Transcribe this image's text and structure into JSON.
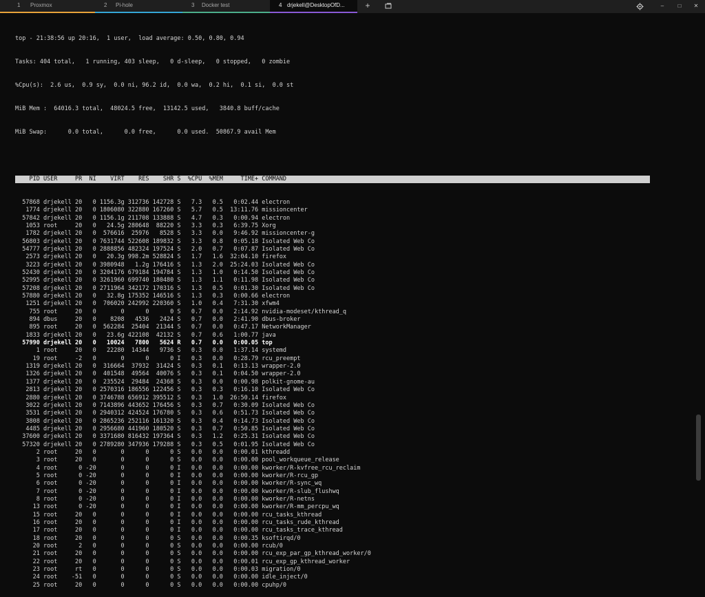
{
  "tabs": [
    {
      "num": "1",
      "title": "Proxmox",
      "color": "#e8a33a",
      "active": false
    },
    {
      "num": "2",
      "title": "Pi-hole",
      "color": "#35a6d6",
      "active": false
    },
    {
      "num": "3",
      "title": "Docker test",
      "color": "#4caf8b",
      "active": false
    },
    {
      "num": "4",
      "title": "drjekell@DesktopOfD...",
      "color": "#8a5ad6",
      "active": true
    }
  ],
  "toolbar": {
    "new_tab": "+",
    "menu_icon": "menu-icon",
    "settings_icon": "gear-icon"
  },
  "window": {
    "minimize": "–",
    "maximize": "□",
    "close": "✕"
  },
  "summary": [
    "top - 21:38:56 up 20:16,  1 user,  load average: 0.50, 0.80, 0.94",
    "Tasks: 404 total,   1 running, 403 sleep,   0 d-sleep,   0 stopped,   0 zombie",
    "%Cpu(s):  2.6 us,  0.9 sy,  0.0 ni, 96.2 id,  0.0 wa,  0.2 hi,  0.1 si,  0.0 st",
    "MiB Mem :  64016.3 total,  48024.5 free,  13142.5 used,   3840.8 buff/cache",
    "MiB Swap:      0.0 total,      0.0 free,      0.0 used.  50867.9 avail Mem"
  ],
  "columns": [
    "PID",
    "USER",
    "PR",
    "NI",
    "VIRT",
    "RES",
    "SHR",
    "S",
    "%CPU",
    "%MEM",
    "TIME+",
    "COMMAND"
  ],
  "processes": [
    [
      "57868",
      "drjekell",
      "20",
      "0",
      "1156.3g",
      "312736",
      "142728",
      "S",
      "7.3",
      "0.5",
      "0:02.44",
      "electron"
    ],
    [
      "1774",
      "drjekell",
      "20",
      "0",
      "1806080",
      "322880",
      "167260",
      "S",
      "5.7",
      "0.5",
      "13:11.76",
      "missioncenter"
    ],
    [
      "57842",
      "drjekell",
      "20",
      "0",
      "1156.1g",
      "211708",
      "133888",
      "S",
      "4.7",
      "0.3",
      "0:00.94",
      "electron"
    ],
    [
      "1053",
      "root",
      "20",
      "0",
      "24.5g",
      "280648",
      "88220",
      "S",
      "3.3",
      "0.3",
      "6:39.75",
      "Xorg"
    ],
    [
      "1782",
      "drjekell",
      "20",
      "0",
      "576616",
      "25976",
      "8528",
      "S",
      "3.3",
      "0.0",
      "9:46.92",
      "missioncenter-g"
    ],
    [
      "56803",
      "drjekell",
      "20",
      "0",
      "7631744",
      "522608",
      "189832",
      "S",
      "3.3",
      "0.8",
      "0:05.18",
      "Isolated Web Co"
    ],
    [
      "54777",
      "drjekell",
      "20",
      "0",
      "2888856",
      "482324",
      "197524",
      "S",
      "2.0",
      "0.7",
      "0:07.87",
      "Isolated Web Co"
    ],
    [
      "2573",
      "drjekell",
      "20",
      "0",
      "20.3g",
      "998.2m",
      "528824",
      "S",
      "1.7",
      "1.6",
      "32:04.10",
      "firefox"
    ],
    [
      "3223",
      "drjekell",
      "20",
      "0",
      "3980948",
      "1.2g",
      "176416",
      "S",
      "1.3",
      "2.0",
      "25:24.03",
      "Isolated Web Co"
    ],
    [
      "52430",
      "drjekell",
      "20",
      "0",
      "3204176",
      "679184",
      "194784",
      "S",
      "1.3",
      "1.0",
      "0:14.50",
      "Isolated Web Co"
    ],
    [
      "52995",
      "drjekell",
      "20",
      "0",
      "3261960",
      "699740",
      "180480",
      "S",
      "1.3",
      "1.1",
      "0:11.98",
      "Isolated Web Co"
    ],
    [
      "57208",
      "drjekell",
      "20",
      "0",
      "2711964",
      "342172",
      "170316",
      "S",
      "1.3",
      "0.5",
      "0:01.30",
      "Isolated Web Co"
    ],
    [
      "57880",
      "drjekell",
      "20",
      "0",
      "32.8g",
      "175352",
      "146516",
      "S",
      "1.3",
      "0.3",
      "0:00.66",
      "electron"
    ],
    [
      "1251",
      "drjekell",
      "20",
      "0",
      "706020",
      "242992",
      "220360",
      "S",
      "1.0",
      "0.4",
      "7:31.30",
      "xfwm4"
    ],
    [
      "755",
      "root",
      "20",
      "0",
      "0",
      "0",
      "0",
      "S",
      "0.7",
      "0.0",
      "2:14.92",
      "nvidia-modeset/kthread_q"
    ],
    [
      "894",
      "dbus",
      "20",
      "0",
      "8208",
      "4536",
      "2424",
      "S",
      "0.7",
      "0.0",
      "2:41.90",
      "dbus-broker"
    ],
    [
      "895",
      "root",
      "20",
      "0",
      "562284",
      "25404",
      "21344",
      "S",
      "0.7",
      "0.0",
      "0:47.17",
      "NetworkManager"
    ],
    [
      "1833",
      "drjekell",
      "20",
      "0",
      "23.6g",
      "422108",
      "42132",
      "S",
      "0.7",
      "0.6",
      "1:00.77",
      "java"
    ],
    [
      "57990",
      "drjekell",
      "20",
      "0",
      "10024",
      "7800",
      "5624",
      "R",
      "0.7",
      "0.0",
      "0:00.05",
      "top"
    ],
    [
      "1",
      "root",
      "20",
      "0",
      "22280",
      "14344",
      "9736",
      "S",
      "0.3",
      "0.0",
      "1:37.14",
      "systemd"
    ],
    [
      "19",
      "root",
      "-2",
      "0",
      "0",
      "0",
      "0",
      "I",
      "0.3",
      "0.0",
      "0:28.79",
      "rcu_preempt"
    ],
    [
      "1319",
      "drjekell",
      "20",
      "0",
      "316664",
      "37932",
      "31424",
      "S",
      "0.3",
      "0.1",
      "0:13.13",
      "wrapper-2.0"
    ],
    [
      "1326",
      "drjekell",
      "20",
      "0",
      "401548",
      "49564",
      "40076",
      "S",
      "0.3",
      "0.1",
      "0:04.50",
      "wrapper-2.0"
    ],
    [
      "1377",
      "drjekell",
      "20",
      "0",
      "235524",
      "29484",
      "24368",
      "S",
      "0.3",
      "0.0",
      "0:00.98",
      "polkit-gnome-au"
    ],
    [
      "2813",
      "drjekell",
      "20",
      "0",
      "2570316",
      "186556",
      "122456",
      "S",
      "0.3",
      "0.3",
      "0:16.10",
      "Isolated Web Co"
    ],
    [
      "2880",
      "drjekell",
      "20",
      "0",
      "3746788",
      "656912",
      "395512",
      "S",
      "0.3",
      "1.0",
      "26:50.14",
      "firefox"
    ],
    [
      "3022",
      "drjekell",
      "20",
      "0",
      "7143896",
      "443652",
      "176456",
      "S",
      "0.3",
      "0.7",
      "0:30.09",
      "Isolated Web Co"
    ],
    [
      "3531",
      "drjekell",
      "20",
      "0",
      "2940312",
      "424524",
      "176780",
      "S",
      "0.3",
      "0.6",
      "0:51.73",
      "Isolated Web Co"
    ],
    [
      "3808",
      "drjekell",
      "20",
      "0",
      "2865236",
      "252116",
      "161320",
      "S",
      "0.3",
      "0.4",
      "0:14.73",
      "Isolated Web Co"
    ],
    [
      "4485",
      "drjekell",
      "20",
      "0",
      "2956680",
      "441960",
      "180520",
      "S",
      "0.3",
      "0.7",
      "0:50.85",
      "Isolated Web Co"
    ],
    [
      "37600",
      "drjekell",
      "20",
      "0",
      "3371680",
      "816432",
      "197364",
      "S",
      "0.3",
      "1.2",
      "0:25.31",
      "Isolated Web Co"
    ],
    [
      "57320",
      "drjekell",
      "20",
      "0",
      "2789280",
      "347936",
      "179288",
      "S",
      "0.3",
      "0.5",
      "0:01.95",
      "Isolated Web Co"
    ],
    [
      "2",
      "root",
      "20",
      "0",
      "0",
      "0",
      "0",
      "S",
      "0.0",
      "0.0",
      "0:00.01",
      "kthreadd"
    ],
    [
      "3",
      "root",
      "20",
      "0",
      "0",
      "0",
      "0",
      "S",
      "0.0",
      "0.0",
      "0:00.00",
      "pool_workqueue_release"
    ],
    [
      "4",
      "root",
      "0",
      "-20",
      "0",
      "0",
      "0",
      "I",
      "0.0",
      "0.0",
      "0:00.00",
      "kworker/R-kvfree_rcu_reclaim"
    ],
    [
      "5",
      "root",
      "0",
      "-20",
      "0",
      "0",
      "0",
      "I",
      "0.0",
      "0.0",
      "0:00.00",
      "kworker/R-rcu_gp"
    ],
    [
      "6",
      "root",
      "0",
      "-20",
      "0",
      "0",
      "0",
      "I",
      "0.0",
      "0.0",
      "0:00.00",
      "kworker/R-sync_wq"
    ],
    [
      "7",
      "root",
      "0",
      "-20",
      "0",
      "0",
      "0",
      "I",
      "0.0",
      "0.0",
      "0:00.00",
      "kworker/R-slub_flushwq"
    ],
    [
      "8",
      "root",
      "0",
      "-20",
      "0",
      "0",
      "0",
      "I",
      "0.0",
      "0.0",
      "0:00.00",
      "kworker/R-netns"
    ],
    [
      "13",
      "root",
      "0",
      "-20",
      "0",
      "0",
      "0",
      "I",
      "0.0",
      "0.0",
      "0:00.00",
      "kworker/R-mm_percpu_wq"
    ],
    [
      "15",
      "root",
      "20",
      "0",
      "0",
      "0",
      "0",
      "I",
      "0.0",
      "0.0",
      "0:00.00",
      "rcu_tasks_kthread"
    ],
    [
      "16",
      "root",
      "20",
      "0",
      "0",
      "0",
      "0",
      "I",
      "0.0",
      "0.0",
      "0:00.00",
      "rcu_tasks_rude_kthread"
    ],
    [
      "17",
      "root",
      "20",
      "0",
      "0",
      "0",
      "0",
      "I",
      "0.0",
      "0.0",
      "0:00.00",
      "rcu_tasks_trace_kthread"
    ],
    [
      "18",
      "root",
      "20",
      "0",
      "0",
      "0",
      "0",
      "S",
      "0.0",
      "0.0",
      "0:00.35",
      "ksoftirqd/0"
    ],
    [
      "20",
      "root",
      "2",
      "0",
      "0",
      "0",
      "0",
      "S",
      "0.0",
      "0.0",
      "0:00.00",
      "rcub/0"
    ],
    [
      "21",
      "root",
      "20",
      "0",
      "0",
      "0",
      "0",
      "S",
      "0.0",
      "0.0",
      "0:00.00",
      "rcu_exp_par_gp_kthread_worker/0"
    ],
    [
      "22",
      "root",
      "20",
      "0",
      "0",
      "0",
      "0",
      "S",
      "0.0",
      "0.0",
      "0:00.01",
      "rcu_exp_gp_kthread_worker"
    ],
    [
      "23",
      "root",
      "rt",
      "0",
      "0",
      "0",
      "0",
      "S",
      "0.0",
      "0.0",
      "0:00.03",
      "migration/0"
    ],
    [
      "24",
      "root",
      "-51",
      "0",
      "0",
      "0",
      "0",
      "S",
      "0.0",
      "0.0",
      "0:00.00",
      "idle_inject/0"
    ],
    [
      "25",
      "root",
      "20",
      "0",
      "0",
      "0",
      "0",
      "S",
      "0.0",
      "0.0",
      "0:00.00",
      "cpuhp/0"
    ]
  ]
}
